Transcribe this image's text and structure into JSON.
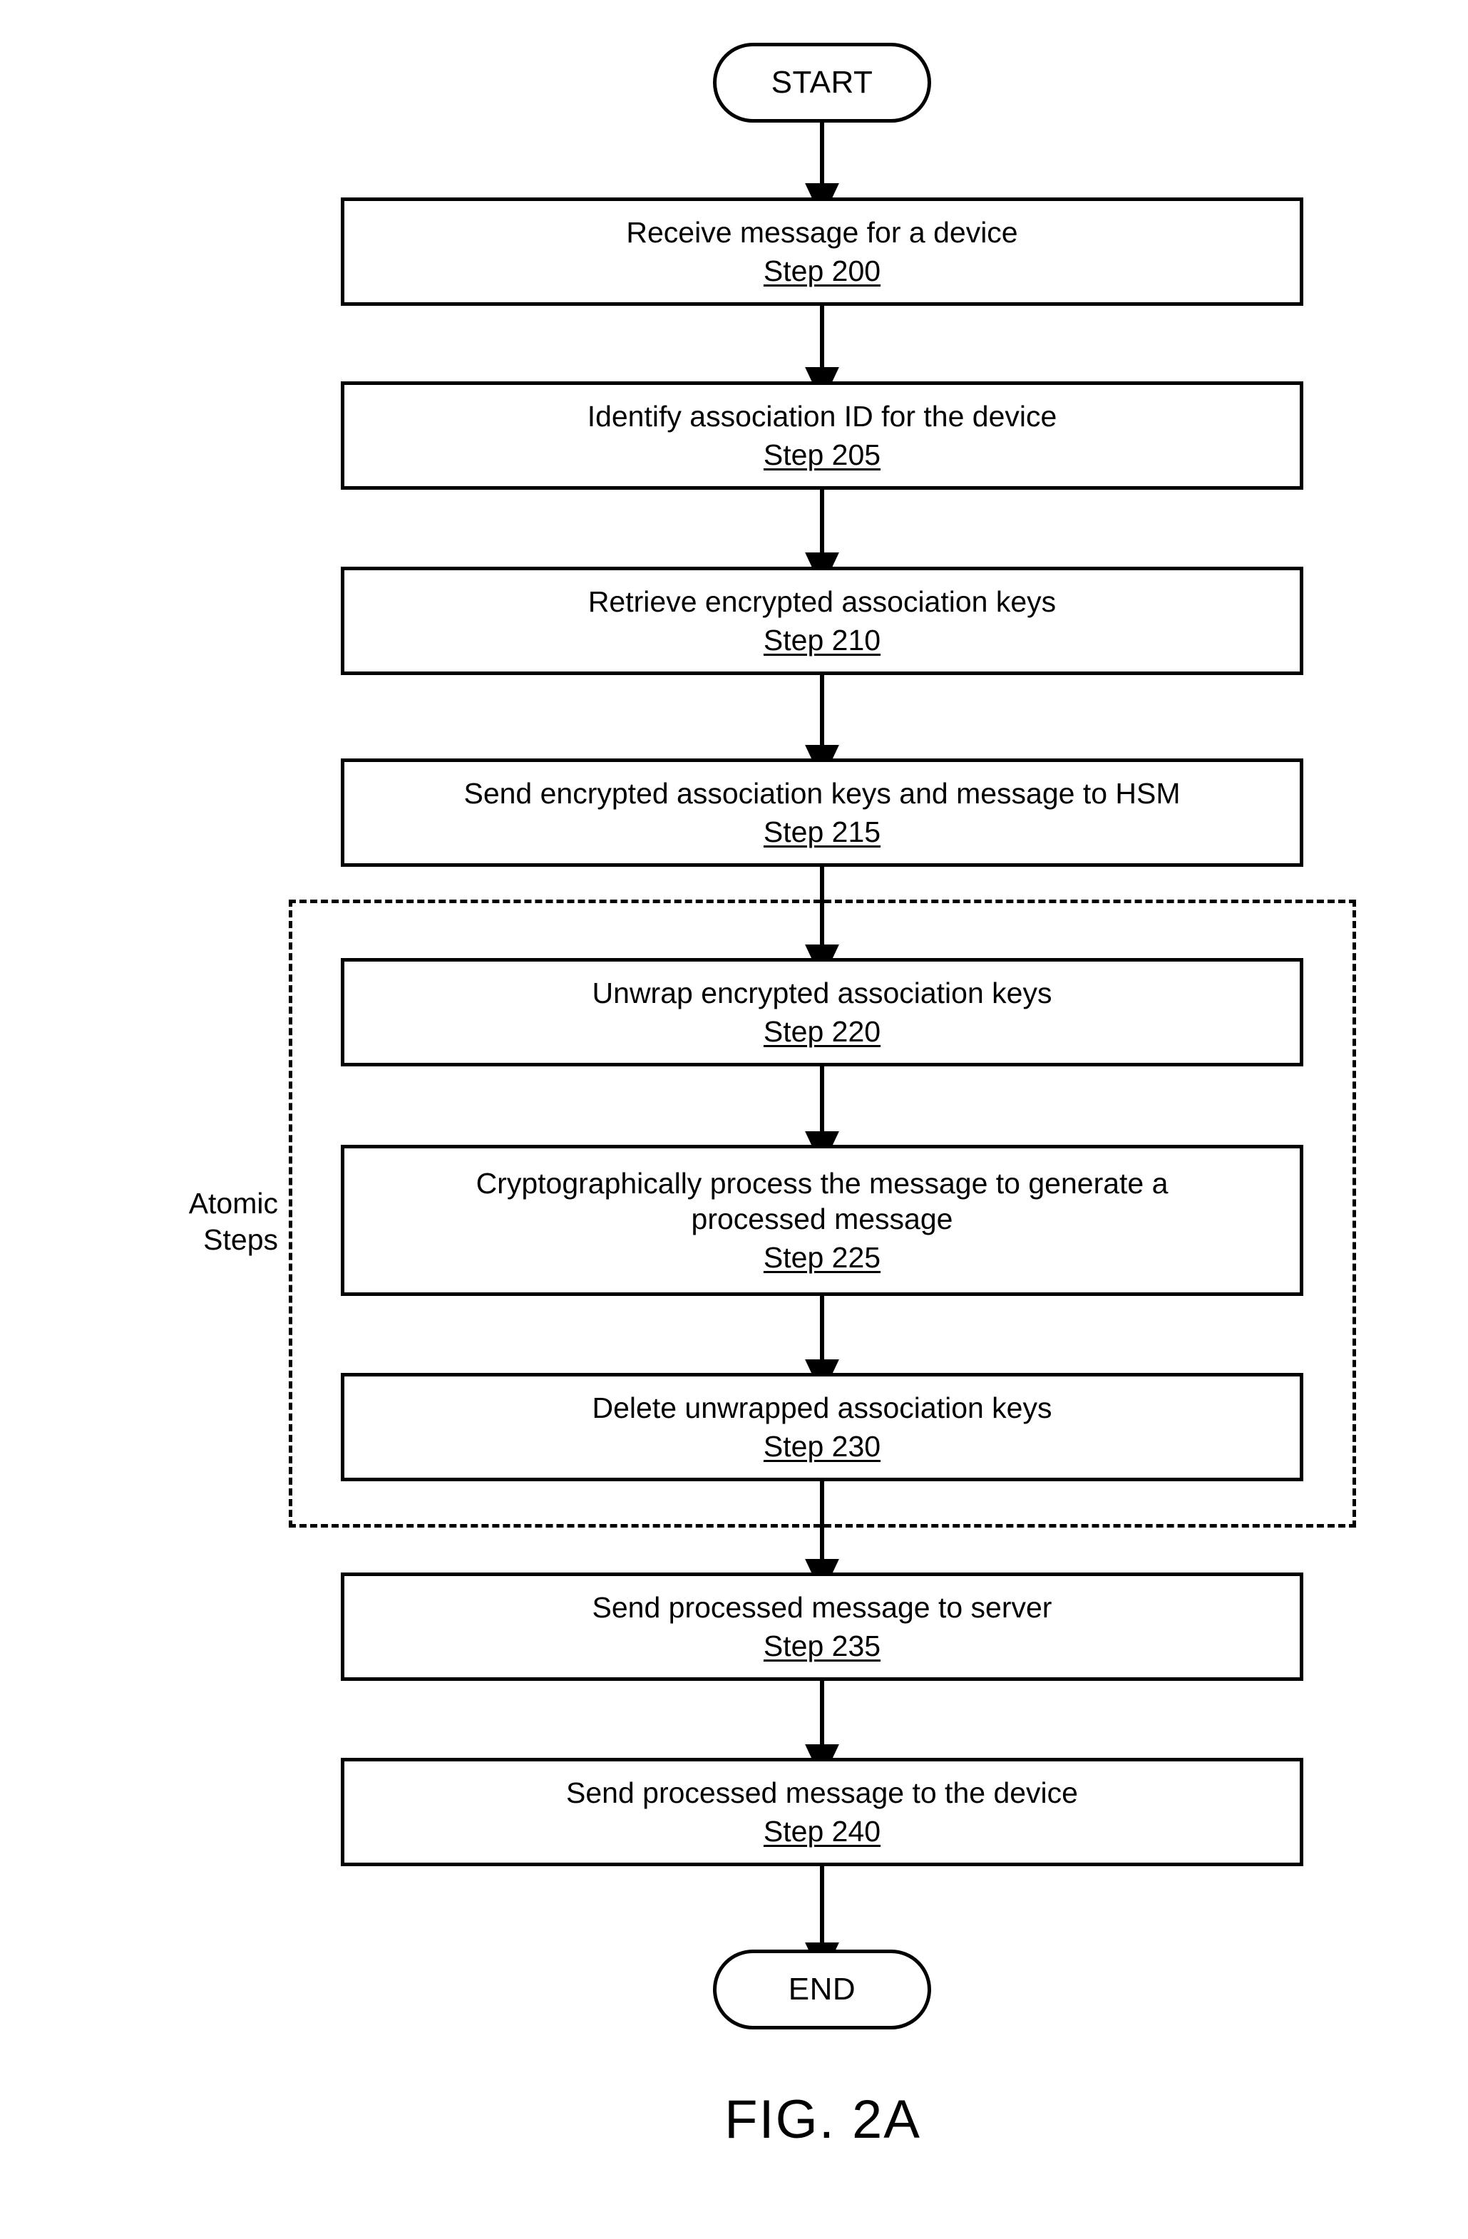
{
  "figure": {
    "caption": "FIG. 2A",
    "start_label": "START",
    "end_label": "END",
    "atomic_group_label": "Atomic\nSteps",
    "stroke_color": "#000000",
    "background_color": "#ffffff"
  },
  "steps": [
    {
      "id": "step-200",
      "text": "Receive message for a device",
      "step_ref": "Step 200"
    },
    {
      "id": "step-205",
      "text": "Identify association ID for the device",
      "step_ref": "Step 205"
    },
    {
      "id": "step-210",
      "text": "Retrieve encrypted association keys",
      "step_ref": "Step 210"
    },
    {
      "id": "step-215",
      "text": "Send encrypted association keys and message to HSM",
      "step_ref": "Step 215"
    },
    {
      "id": "step-220",
      "text": "Unwrap encrypted association keys",
      "step_ref": "Step 220"
    },
    {
      "id": "step-225",
      "text": "Cryptographically process the message to generate a\nprocessed message",
      "step_ref": "Step 225"
    },
    {
      "id": "step-230",
      "text": "Delete unwrapped association keys",
      "step_ref": "Step 230"
    },
    {
      "id": "step-235",
      "text": "Send processed message to server",
      "step_ref": "Step 235"
    },
    {
      "id": "step-240",
      "text": "Send processed message to the device",
      "step_ref": "Step 240"
    }
  ],
  "chart_data": {
    "type": "diagram",
    "diagram_kind": "flowchart",
    "title": "FIG. 2A",
    "nodes": [
      {
        "id": "start",
        "shape": "terminator",
        "label": "START"
      },
      {
        "id": "step-200",
        "shape": "process",
        "label": "Receive message for a device",
        "ref": "Step 200"
      },
      {
        "id": "step-205",
        "shape": "process",
        "label": "Identify association ID for the device",
        "ref": "Step 205"
      },
      {
        "id": "step-210",
        "shape": "process",
        "label": "Retrieve encrypted association keys",
        "ref": "Step 210"
      },
      {
        "id": "step-215",
        "shape": "process",
        "label": "Send encrypted association keys and message to HSM",
        "ref": "Step 215"
      },
      {
        "id": "step-220",
        "shape": "process",
        "label": "Unwrap encrypted association keys",
        "ref": "Step 220",
        "group": "Atomic Steps"
      },
      {
        "id": "step-225",
        "shape": "process",
        "label": "Cryptographically process the message to generate a processed message",
        "ref": "Step 225",
        "group": "Atomic Steps"
      },
      {
        "id": "step-230",
        "shape": "process",
        "label": "Delete unwrapped association keys",
        "ref": "Step 230",
        "group": "Atomic Steps"
      },
      {
        "id": "step-235",
        "shape": "process",
        "label": "Send processed message to server",
        "ref": "Step 235"
      },
      {
        "id": "step-240",
        "shape": "process",
        "label": "Send processed message to the device",
        "ref": "Step 240"
      },
      {
        "id": "end",
        "shape": "terminator",
        "label": "END"
      }
    ],
    "edges": [
      {
        "from": "start",
        "to": "step-200"
      },
      {
        "from": "step-200",
        "to": "step-205"
      },
      {
        "from": "step-205",
        "to": "step-210"
      },
      {
        "from": "step-210",
        "to": "step-215"
      },
      {
        "from": "step-215",
        "to": "step-220"
      },
      {
        "from": "step-220",
        "to": "step-225"
      },
      {
        "from": "step-225",
        "to": "step-230"
      },
      {
        "from": "step-230",
        "to": "step-235"
      },
      {
        "from": "step-235",
        "to": "step-240"
      },
      {
        "from": "step-240",
        "to": "end"
      }
    ],
    "groups": [
      {
        "label": "Atomic Steps",
        "style": "dashed",
        "members": [
          "step-220",
          "step-225",
          "step-230"
        ]
      }
    ]
  }
}
